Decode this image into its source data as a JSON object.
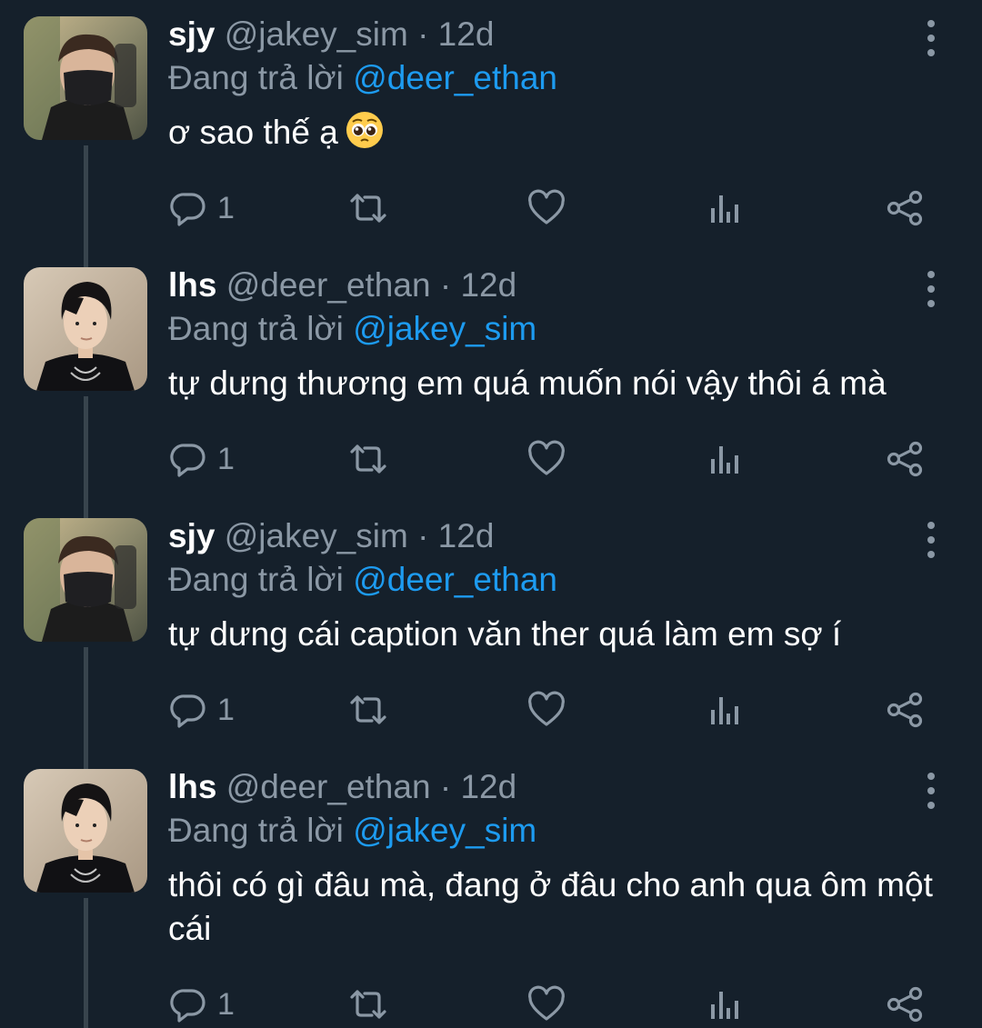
{
  "tweets": [
    {
      "name": "sjy",
      "handle": "@jakey_sim",
      "separator": "·",
      "time": "12d",
      "reply_prefix": "Đang trả lời",
      "reply_to": "@deer_ethan",
      "text": "ơ sao thế ạ",
      "emoji": "pleading-face",
      "reply_count": "1",
      "avatar": "masked"
    },
    {
      "name": "lhs",
      "handle": "@deer_ethan",
      "separator": "·",
      "time": "12d",
      "reply_prefix": "Đang trả lời",
      "reply_to": "@jakey_sim",
      "text": "tự dưng thương em quá muốn nói vậy thôi á mà",
      "reply_count": "1",
      "avatar": "portrait"
    },
    {
      "name": "sjy",
      "handle": "@jakey_sim",
      "separator": "·",
      "time": "12d",
      "reply_prefix": "Đang trả lời",
      "reply_to": "@deer_ethan",
      "text": "tự dưng cái caption văn ther quá làm em sợ í",
      "reply_count": "1",
      "avatar": "masked"
    },
    {
      "name": "lhs",
      "handle": "@deer_ethan",
      "separator": "·",
      "time": "12d",
      "reply_prefix": "Đang trả lời",
      "reply_to": "@jakey_sim",
      "text": "thôi có gì đâu mà, đang ở đâu cho anh qua ôm một cái",
      "reply_count": "1",
      "avatar": "portrait"
    }
  ],
  "icons": {
    "reply": "reply-icon",
    "retweet": "retweet-icon",
    "like": "heart-icon",
    "analytics": "analytics-icon",
    "share": "share-icon",
    "more": "more-vertical-icon"
  },
  "colors": {
    "background": "#15202b",
    "primary_text": "#ffffff",
    "secondary_text": "#8b98a5",
    "mention": "#1d9bf0",
    "thread_line": "#38444d"
  }
}
